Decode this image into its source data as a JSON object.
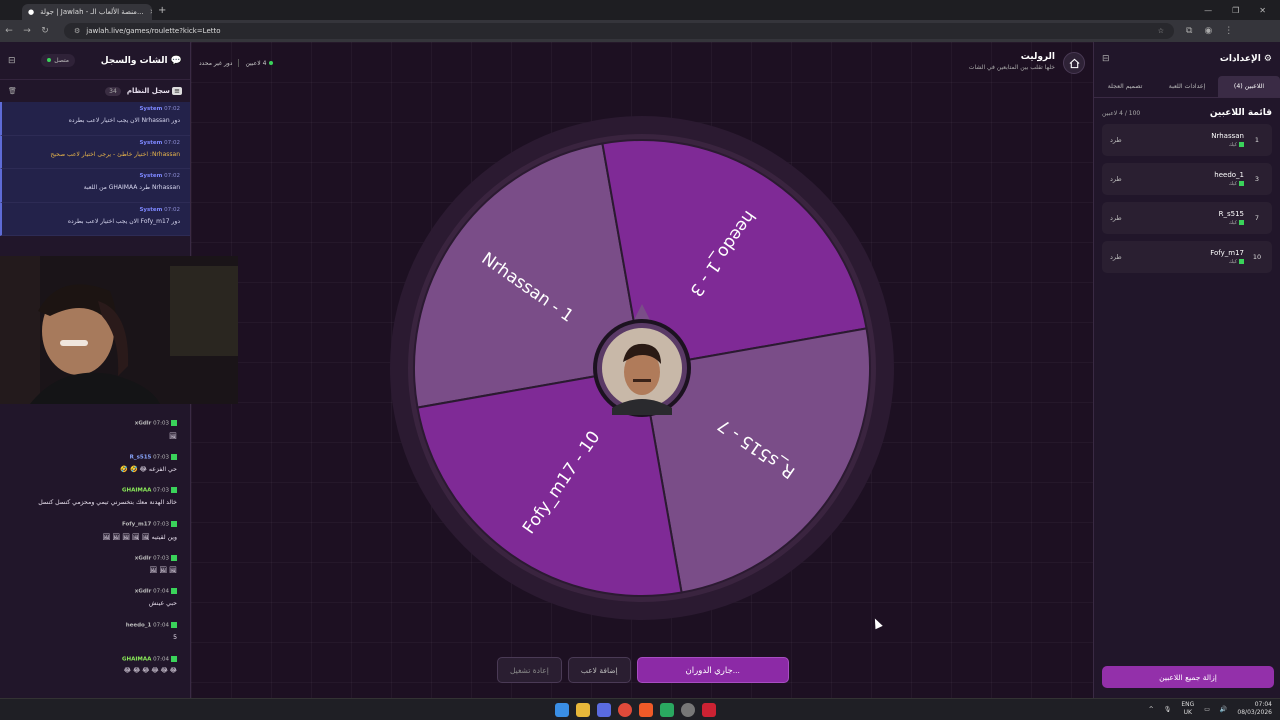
{
  "browser": {
    "tab_title": "جولة | Jawlah - منصة الألعاب الـ...",
    "url": "jawlah.live/games/roulette?kick=Letto"
  },
  "chat": {
    "title": "الشات والسجل",
    "status": "متصل",
    "system_log_title": "سجل النظام",
    "system_log_count": "34",
    "system_messages": [
      {
        "sender": "System",
        "time": "07:02",
        "text": "دور Nrhassan الان يجب اختيار لاعب بطرده",
        "warn": false
      },
      {
        "sender": "System",
        "time": "07:02",
        "text": "Nrhassan: اختيار خاطئ - يرجى اختيار لاعب صحيح",
        "warn": true
      },
      {
        "sender": "System",
        "time": "07:02",
        "text": "Nrhassan طرد GHAIMAA من اللعبة",
        "warn": false
      },
      {
        "sender": "System",
        "time": "07:02",
        "text": "دور Fofy_m17 الان يجب اختيار لاعب بطرده",
        "warn": false
      }
    ],
    "messages": [
      {
        "user": "xGdlr",
        "time": "07:03",
        "text": "🖼",
        "color": "#ffffff"
      },
      {
        "user": "R_s515",
        "time": "07:03",
        "text": "حي الفزعه 😂 🤣 🤣",
        "color": "#8aa8ff"
      },
      {
        "user": "GHAIMAA",
        "time": "07:03",
        "text": "خالد الهدنة معك بتخسرني تيمي ومحزمي كنسل كنسل",
        "color": "#8df05a"
      },
      {
        "user": "Fofy_m17",
        "time": "07:03",
        "text": "وين لقيتيه 🖼 🖼 🖼 🖼 🖼",
        "color": "#ffffff"
      },
      {
        "user": "xGdlr",
        "time": "07:03",
        "text": "🖼 🖼 🖼",
        "color": "#ffffff"
      },
      {
        "user": "xGdlr",
        "time": "07:04",
        "text": "حبي عينش",
        "color": "#ffffff"
      },
      {
        "user": "heedo_1",
        "time": "07:04",
        "text": "5",
        "color": "#ffffff"
      },
      {
        "user": "GHAIMAA",
        "time": "07:04",
        "text": "😂 😂 😂 😂 😂 😂",
        "color": "#8df05a"
      }
    ]
  },
  "game": {
    "title": "الروليت",
    "subtitle": "خلها تقلب بين المتابعين في الشات",
    "players_count": "4 لاعبين",
    "turn_text": "دور غير محدد",
    "wheel_segments": [
      {
        "label": "Nrhassan - 1",
        "color": "#7a4d88"
      },
      {
        "label": "heedo_1 - 3",
        "color": "#7f2a96"
      },
      {
        "label": "R_s515 - 7",
        "color": "#7a4d88"
      },
      {
        "label": "Fofy_m17 - 10",
        "color": "#7f2a96"
      }
    ],
    "restart_label": "إعادة تشغيل",
    "add_player_label": "إضافة لاعب",
    "spin_label": "جاري الدوران..."
  },
  "settings": {
    "title": "الإعدادات",
    "tabs": [
      "اللاعبين (4)",
      "إعدادات اللعبة",
      "تصميم العجلة"
    ],
    "list_title": "قائمة اللاعبين",
    "list_count": "100 / 4 لاعبين",
    "platform_label": "كيك",
    "kick_label": "طرد",
    "players": [
      {
        "num": "1",
        "name": "Nrhassan"
      },
      {
        "num": "3",
        "name": "heedo_1"
      },
      {
        "num": "7",
        "name": "R_s515"
      },
      {
        "num": "10",
        "name": "Fofy_m17"
      }
    ],
    "remove_all_label": "إزالة جميع اللاعبين"
  },
  "taskbar": {
    "lang": "ENG",
    "region": "UK",
    "time": "07:04",
    "date": "08/03/2026"
  },
  "colors": {
    "accent": "#8c2aa6",
    "online": "#3ad35a",
    "system": "#7d87ff"
  }
}
